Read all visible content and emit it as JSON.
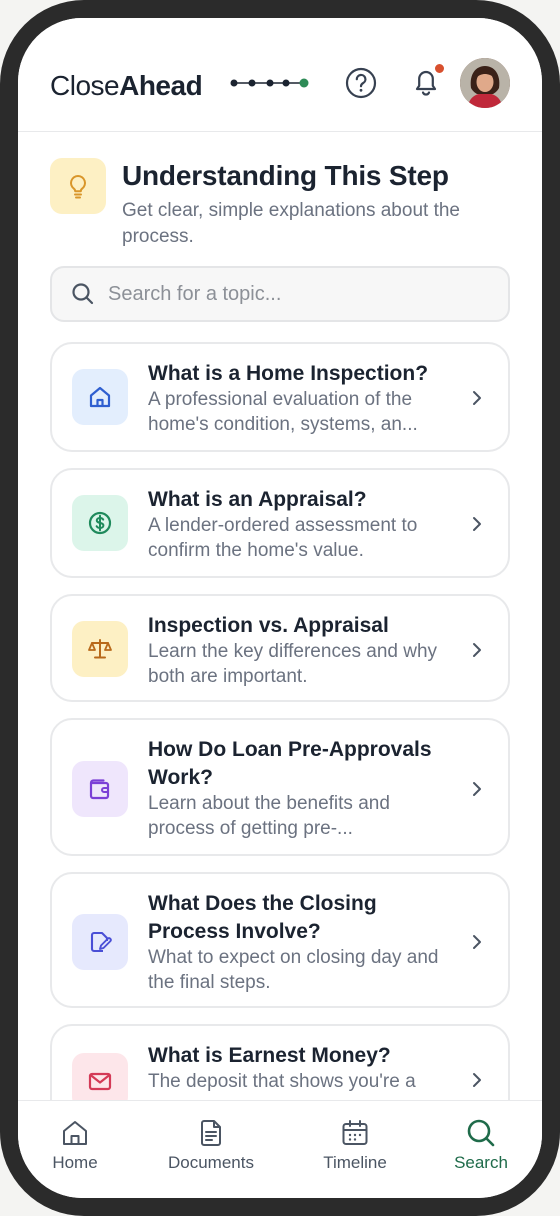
{
  "header": {
    "brand_part1": "Close",
    "brand_part2": "Ahead",
    "progress_steps": 5,
    "progress_current": 5,
    "notification_dot_color": "#d8502e"
  },
  "section": {
    "icon": "lightbulb-icon",
    "title": "Understanding This Step",
    "subtitle": "Get clear, simple explanations about the process."
  },
  "search": {
    "placeholder": "Search for a topic...",
    "value": ""
  },
  "topics": [
    {
      "icon": "home-icon",
      "title": "What is a Home Inspection?",
      "description": "A professional evaluation of the home's condition, systems, an...",
      "bg": "#e3eefd",
      "color": "#2f5fd0"
    },
    {
      "icon": "dollar-icon",
      "title": "What is an Appraisal?",
      "description": "A lender-ordered assessment to confirm the home's value.",
      "bg": "#dcf5ea",
      "color": "#1f8a5c"
    },
    {
      "icon": "scale-icon",
      "title": "Inspection vs. Appraisal",
      "description": "Learn the key differences and why both are important.",
      "bg": "#fdf0c4",
      "color": "#b8691a"
    },
    {
      "icon": "wallet-icon",
      "title": "How Do Loan Pre-Approvals Work?",
      "description": "Learn about the benefits and process of getting pre-...",
      "bg": "#efe6fc",
      "color": "#7b3fd6"
    },
    {
      "icon": "document-pen-icon",
      "title": "What Does the Closing Process Involve?",
      "description": "What to expect on closing day and the final steps.",
      "bg": "#e6e9fd",
      "color": "#4a4fd6"
    },
    {
      "icon": "mail-icon",
      "title": "What is Earnest Money?",
      "description": "The deposit that shows you're a",
      "bg": "#fde6ea",
      "color": "#d43a57"
    }
  ],
  "nav": {
    "home": "Home",
    "documents": "Documents",
    "timeline": "Timeline",
    "search": "Search",
    "active": "search",
    "accent": "#1f6b4a"
  }
}
